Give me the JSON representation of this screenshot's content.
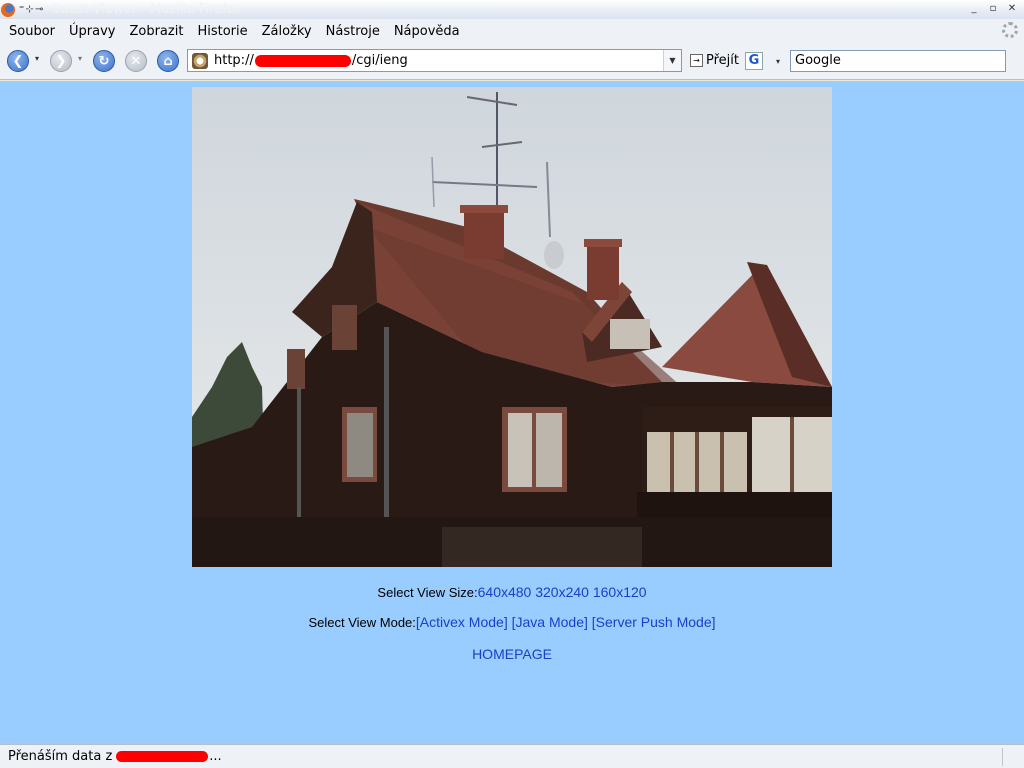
{
  "window": {
    "title": "Guest Viewer - Mozilla Firefox",
    "buttons": [
      "_",
      "▫",
      "✕"
    ]
  },
  "menu": {
    "items": [
      "Soubor",
      "Úpravy",
      "Zobrazit",
      "Historie",
      "Záložky",
      "Nástroje",
      "Nápověda"
    ]
  },
  "toolbar": {
    "back_drop": "▾",
    "forward_drop": "▾",
    "url_prefix": "http://",
    "url_suffix": "/cgi/ieng",
    "url_drop": "▼",
    "go_label": "Přejít",
    "go_icon": "→",
    "search_engine_icon": "G",
    "search_engine_drop": "▾",
    "search_value": "Google"
  },
  "icons": {
    "back": "❮",
    "forward": "❯",
    "reload": "↻",
    "stop": "✕",
    "home": "⌂"
  },
  "page": {
    "size_label": "Select View Size:",
    "sizes": [
      "640x480",
      "320x240",
      "160x120"
    ],
    "mode_label": "Select View Mode:",
    "modes": [
      "[Activex Mode]",
      "[Java Mode]",
      "[Server Push Mode]"
    ],
    "homepage": "HOMEPAGE"
  },
  "status": {
    "text_prefix": "Přenáším data z",
    "text_suffix": "..."
  },
  "colors": {
    "page_background": "#99ccff",
    "link": "#1a3fcc",
    "redaction": "#ff0000"
  }
}
